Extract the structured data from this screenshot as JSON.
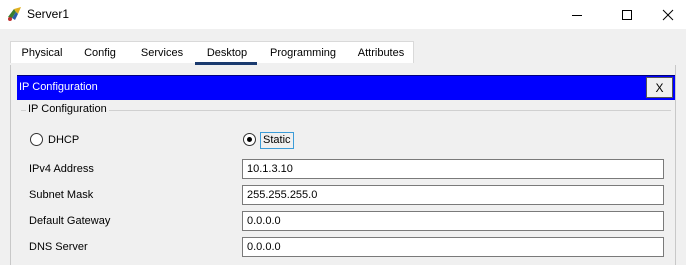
{
  "window": {
    "title": "Server1",
    "icon": "server-app-icon",
    "controls": [
      "minimize-icon",
      "maximize-icon",
      "close-icon"
    ]
  },
  "tabs": [
    {
      "label": "Physical",
      "active": false
    },
    {
      "label": "Config",
      "active": false
    },
    {
      "label": "Services",
      "active": false
    },
    {
      "label": "Desktop",
      "active": true
    },
    {
      "label": "Programming",
      "active": false
    },
    {
      "label": "Attributes",
      "active": false
    }
  ],
  "ip_config": {
    "header": "IP Configuration",
    "close_label": "X",
    "group_title": "IP Configuration",
    "header_color": "#0000ff",
    "modes": [
      {
        "label": "DHCP",
        "selected": false
      },
      {
        "label": "Static",
        "selected": true
      }
    ],
    "fields": [
      {
        "label": "IPv4 Address",
        "value": "10.1.3.10"
      },
      {
        "label": "Subnet Mask",
        "value": "255.255.255.0"
      },
      {
        "label": "Default Gateway",
        "value": "0.0.0.0"
      },
      {
        "label": "DNS Server",
        "value": "0.0.0.0"
      }
    ]
  }
}
